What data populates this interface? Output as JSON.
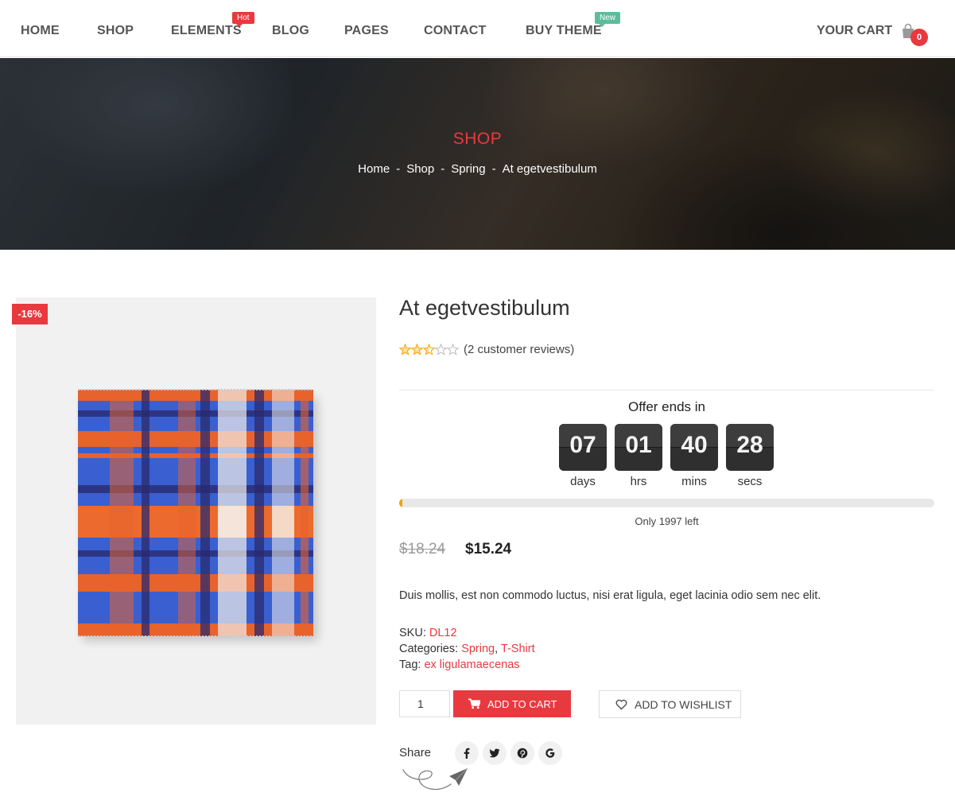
{
  "nav": {
    "items": [
      "HOME",
      "SHOP",
      "ELEMENTS",
      "BLOG",
      "PAGES",
      "CONTACT",
      "BUY THEME"
    ],
    "badges": {
      "elements": "Hot",
      "buy_theme": "New"
    },
    "cart_label": "YOUR CART",
    "cart_count": "0",
    "cart_icon": "shopping-bag-icon"
  },
  "hero": {
    "title": "SHOP",
    "breadcrumb": [
      "Home",
      "Shop",
      "Spring",
      "At egetvestibulum"
    ],
    "separator": "-"
  },
  "product": {
    "discount_badge": "-16%",
    "image": "plaid-scarf-product-image",
    "title": "At egetvestibulum",
    "rating": 2.5,
    "rating_max": 5,
    "reviews": "(2 customer reviews)",
    "offer_label": "Offer ends in",
    "countdown": [
      {
        "value": "07",
        "unit": "days"
      },
      {
        "value": "01",
        "unit": "hrs"
      },
      {
        "value": "40",
        "unit": "mins"
      },
      {
        "value": "28",
        "unit": "secs"
      }
    ],
    "stock_fraction": 0.005,
    "stock_text": "Only 1997 left",
    "old_price": "$18.24",
    "new_price": "$15.24",
    "description": "Duis mollis, est non commodo luctus, nisi erat ligula, eget lacinia odio sem nec elit.",
    "sku_label": "SKU:",
    "sku": "DL12",
    "categories_label": "Categories:",
    "categories": [
      "Spring",
      "T-Shirt"
    ],
    "category_separator": ",",
    "tag_label": "Tag:",
    "tag": "ex ligulamaecenas",
    "quantity": "1",
    "add_to_cart": "ADD TO CART",
    "add_to_wishlist": "ADD TO WISHLIST",
    "share_label": "Share",
    "share_icons": [
      "facebook-icon",
      "twitter-icon",
      "pinterest-icon",
      "google-icon"
    ]
  },
  "colors": {
    "accent": "#e8393f",
    "badge_new": "#5bbd9c",
    "star": "#f3a200",
    "countdown_bg": "#2f2f2f"
  }
}
